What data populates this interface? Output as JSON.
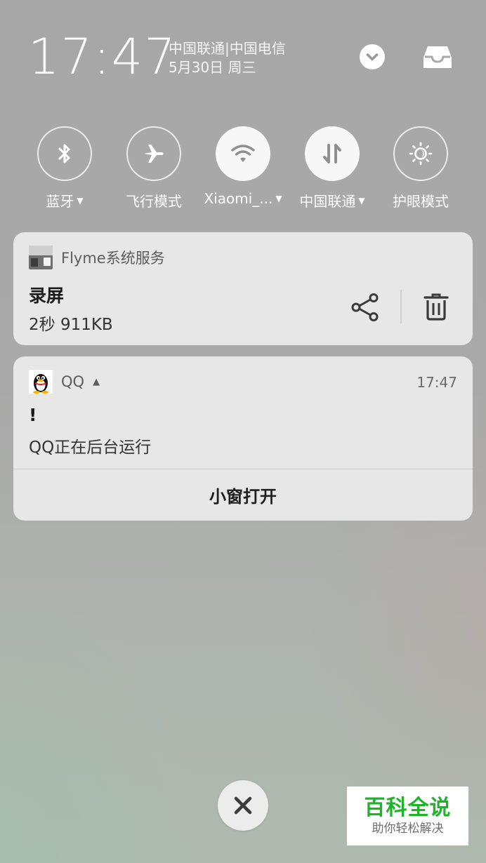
{
  "status": {
    "time": "17:47",
    "carriers": "中国联通|中国电信",
    "date": "5月30日 周三"
  },
  "icons": {
    "expand": "chevron-down-icon",
    "inbox": "inbox-tray-icon",
    "share": "share-icon",
    "delete": "trash-icon",
    "close": "close-icon"
  },
  "toggles": [
    {
      "label": "蓝牙",
      "dropdown": true,
      "icon": "bluetooth-icon",
      "active": false
    },
    {
      "label": "飞行模式",
      "dropdown": false,
      "icon": "airplane-icon",
      "active": false
    },
    {
      "label": "Xiaomi_...",
      "dropdown": true,
      "icon": "wifi-icon",
      "active": true
    },
    {
      "label": "中国联通",
      "dropdown": true,
      "icon": "mobile-data-icon",
      "active": true
    },
    {
      "label": "护眼模式",
      "dropdown": false,
      "icon": "eye-care-icon",
      "active": false
    }
  ],
  "notifications": {
    "recording": {
      "app_name": "Flyme系统服务",
      "title": "录屏",
      "subtitle": "2秒  911KB"
    },
    "qq": {
      "app_name": "QQ",
      "time": "17:47",
      "title": "!",
      "body": "QQ正在后台运行",
      "action": "小窗打开"
    }
  },
  "watermark": {
    "line1": "百科全说",
    "line2": "助你轻松解决"
  },
  "colors": {
    "card_bg": "#e7e7e7",
    "watermark_green": "#1fb32a",
    "text_white": "#fafafa"
  }
}
